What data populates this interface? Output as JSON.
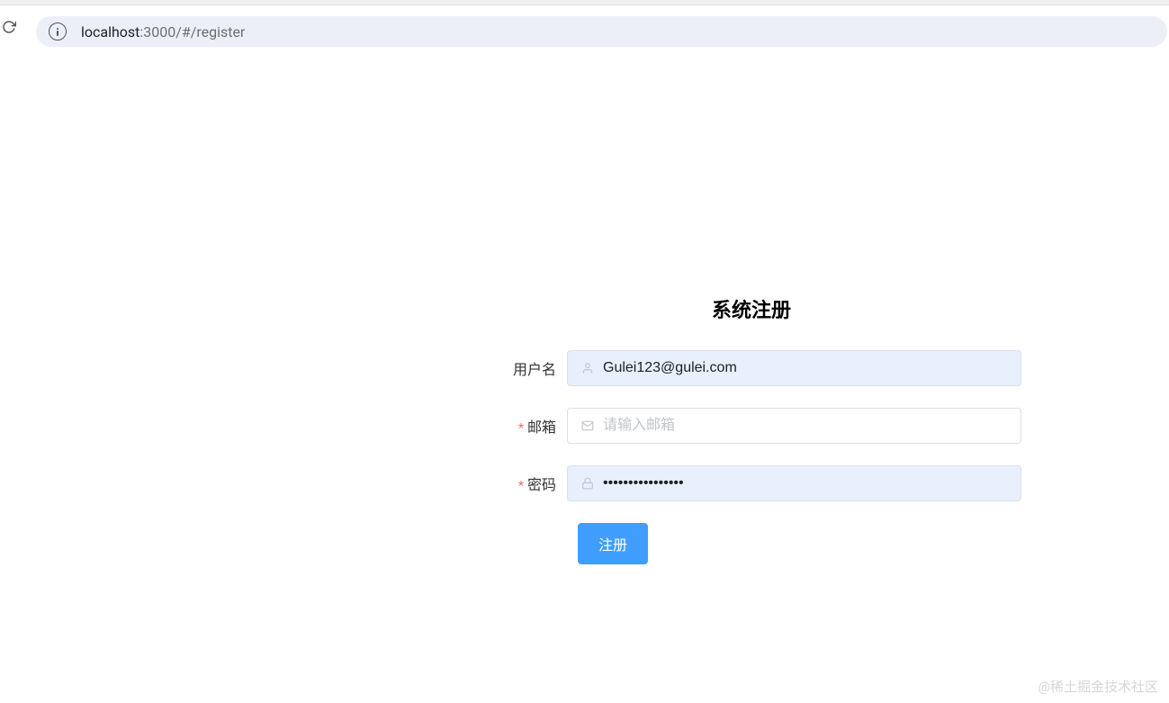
{
  "browser": {
    "url_host": "localhost",
    "url_port_path": ":3000/#/register"
  },
  "form": {
    "title": "系统注册",
    "username": {
      "label": "用户名",
      "value": "Gulei123@gulei.com"
    },
    "email": {
      "label": "邮箱",
      "placeholder": "请输入邮箱",
      "required_mark": "*"
    },
    "password": {
      "label": "密码",
      "value": "••••••••••••••••",
      "required_mark": "*"
    },
    "submit_label": "注册"
  },
  "watermark": "@稀土掘金技术社区"
}
